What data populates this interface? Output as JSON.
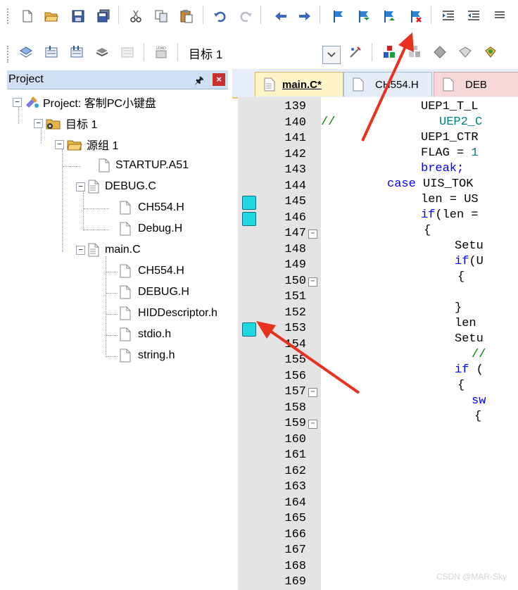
{
  "toolbar1": {
    "buttons": [
      "new-file-icon",
      "open-folder-icon",
      "save-icon",
      "save-all-icon",
      "cut-icon",
      "copy-icon",
      "paste-icon",
      "undo-icon",
      "redo-icon",
      "back-icon",
      "forward-icon",
      "set-bookmark-icon",
      "previous-bookmark-icon",
      "next-bookmark-icon",
      "clear-bookmarks-icon",
      "indent-icon",
      "unindent-icon"
    ]
  },
  "toolbar2": {
    "target": "目标 1",
    "load_label": "LOAD"
  },
  "project": {
    "title": "Project",
    "root": "Project: 客制PC小键盘",
    "target": "目标 1",
    "group": "源组 1",
    "files": [
      {
        "name": "STARTUP.A51"
      },
      {
        "name": "DEBUG.C",
        "children": [
          "CH554.H",
          "Debug.H"
        ]
      },
      {
        "name": "main.C",
        "children": [
          "CH554.H",
          "DEBUG.H",
          "HIDDescriptor.h",
          "stdio.h",
          "string.h"
        ]
      }
    ]
  },
  "editor": {
    "tabs": [
      {
        "label": "main.C*",
        "active": true
      },
      {
        "label": "CH554.H",
        "active": false
      },
      {
        "label": "DEB",
        "active": false
      }
    ],
    "line_numbers": [
      "139",
      "140",
      "141",
      "142",
      "143",
      "144",
      "145",
      "146",
      "147",
      "148",
      "149",
      "150",
      "151",
      "152",
      "153",
      "154",
      "155",
      "156",
      "157",
      "158",
      "159",
      "160",
      "161",
      "162",
      "163",
      "164",
      "165",
      "166",
      "167",
      "168",
      "169"
    ],
    "bookmarked_lines": [
      145,
      146,
      153
    ],
    "fold_lines": [
      147,
      150,
      157,
      159
    ],
    "code": {
      "l139": "UEP1_T_L",
      "l140_comment": "//",
      "l140_rest": "UEP2_C",
      "l141": "UEP1_CTR",
      "l142_a": "FLAG = ",
      "l142_b": "1",
      "l143": "break;",
      "l144_kw": "case",
      "l144_rest": " UIS_TOK",
      "l145": "len = US",
      "l146_kw": "if",
      "l146_rest": "(len =",
      "l147": "{",
      "l148": "Setu",
      "l149_kw": "if",
      "l149_rest": "(U",
      "l150": "{",
      "l152": "}",
      "l153": "len",
      "l154": "Setu",
      "l155": "//",
      "l156_kw": "if",
      "l156_rest": " (",
      "l157": "{",
      "l158": "sw",
      "l159": "{"
    }
  },
  "watermark": "CSDN @MAR-Sky"
}
